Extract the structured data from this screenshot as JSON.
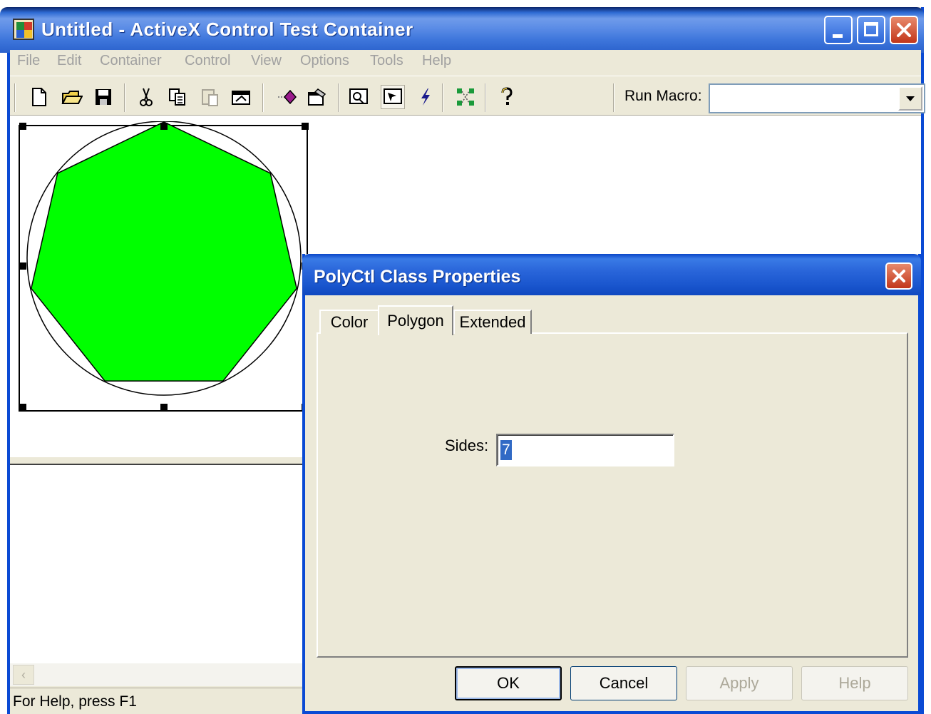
{
  "window": {
    "title": "Untitled - ActiveX Control Test Container"
  },
  "menu": {
    "items": [
      "File",
      "Edit",
      "Container",
      "Control",
      "View",
      "Options",
      "Tools",
      "Help"
    ]
  },
  "toolbar": {
    "icons": [
      "new-file-icon",
      "open-folder-icon",
      "save-icon",
      "cut-icon",
      "copy-icon",
      "paste-icon",
      "insert-control-icon",
      "invoke-method-icon",
      "properties-icon",
      "ambient-icon",
      "design-mode-icon",
      "events-icon",
      "connections-icon",
      "help-icon"
    ],
    "run_macro_label": "Run Macro:",
    "run_macro_value": ""
  },
  "control": {
    "shape": "heptagon",
    "fill_color": "#00ff00",
    "outline_color": "#000000"
  },
  "status_bar": {
    "text": "For Help, press F1"
  },
  "dialog": {
    "title": "PolyCtl Class Properties",
    "tabs": [
      {
        "label": "Color",
        "active": false
      },
      {
        "label": "Polygon",
        "active": true
      },
      {
        "label": "Extended",
        "active": false
      }
    ],
    "sides_label": "Sides:",
    "sides_value": "7",
    "buttons": {
      "ok": "OK",
      "cancel": "Cancel",
      "apply": "Apply",
      "help": "Help"
    }
  },
  "colors": {
    "xp_blue": "#0a4ad4",
    "face": "#ece9d8",
    "selection": "#316ac5"
  }
}
